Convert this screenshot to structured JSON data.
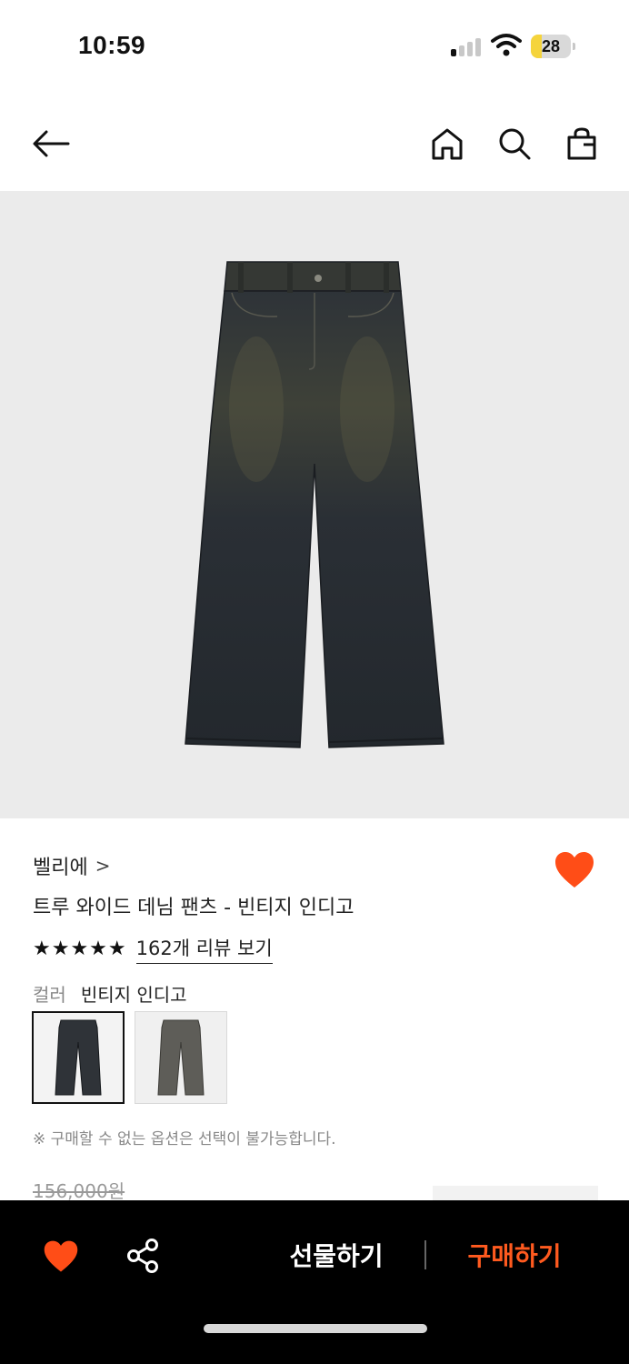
{
  "status": {
    "time": "10:59",
    "battery": "28",
    "battery_level": 0.28,
    "signal_bars_active": 1
  },
  "nav": {
    "back_icon": "arrow-left-icon",
    "home_icon": "home-icon",
    "search_icon": "search-icon",
    "bag_icon": "shopping-bag-icon"
  },
  "product": {
    "image_desc_icon": "jeans-icon",
    "brand": "벨리에",
    "brand_chevron": ">",
    "title": "트루 와이드 데님 팬츠 - 빈티지 인디고",
    "rating_stars": "★★★★★",
    "rating_value": 5,
    "review_link": "162개 리뷰 보기",
    "color_label": "컬러",
    "color_value": "빈티지 인디고",
    "swatches": [
      {
        "name": "빈티지 인디고",
        "selected": true,
        "color": "#2f3338"
      },
      {
        "name": "그레이",
        "selected": false,
        "color": "#5e5d58"
      }
    ],
    "notice": "※ 구매할 수 없는 옵션은 선택이 불가능합니다.",
    "original_price": "156,000원",
    "wishlisted": true
  },
  "bottom_bar": {
    "gift_label": "선물하기",
    "buy_label": "구매하기"
  },
  "colors": {
    "accent": "#ff5a1f",
    "heart": "#ff4d17",
    "hero_bg": "#ebebeb",
    "bottom_bar_bg": "#000000"
  }
}
